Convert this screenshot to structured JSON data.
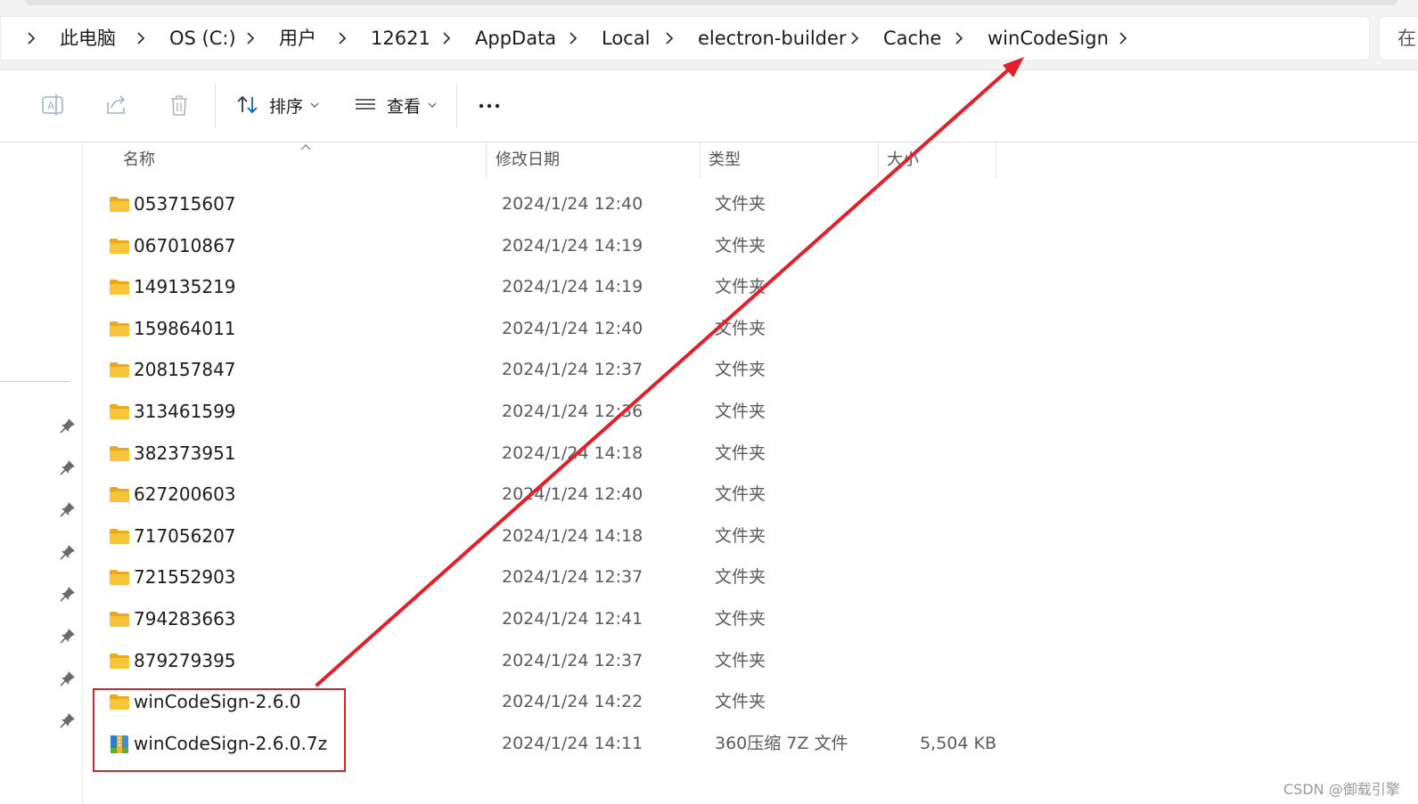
{
  "breadcrumb": [
    "此电脑",
    "OS (C:)",
    "用户",
    "12621",
    "AppData",
    "Local",
    "electron-builder",
    "Cache",
    "winCodeSign"
  ],
  "search_placeholder": "在",
  "toolbar": {
    "rename_icon": "rename-icon",
    "share_icon": "share-icon",
    "delete_icon": "trash-icon",
    "sort_label": "排序",
    "view_label": "查看",
    "more_label": "..."
  },
  "columns": {
    "name": "名称",
    "date": "修改日期",
    "type": "类型",
    "size": "大小"
  },
  "files": [
    {
      "name": "053715607",
      "date": "2024/1/24 12:40",
      "type": "文件夹",
      "size": "",
      "icon": "folder-icon"
    },
    {
      "name": "067010867",
      "date": "2024/1/24 14:19",
      "type": "文件夹",
      "size": "",
      "icon": "folder-icon"
    },
    {
      "name": "149135219",
      "date": "2024/1/24 14:19",
      "type": "文件夹",
      "size": "",
      "icon": "folder-icon"
    },
    {
      "name": "159864011",
      "date": "2024/1/24 12:40",
      "type": "文件夹",
      "size": "",
      "icon": "folder-icon"
    },
    {
      "name": "208157847",
      "date": "2024/1/24 12:37",
      "type": "文件夹",
      "size": "",
      "icon": "folder-icon"
    },
    {
      "name": "313461599",
      "date": "2024/1/24 12:36",
      "type": "文件夹",
      "size": "",
      "icon": "folder-icon"
    },
    {
      "name": "382373951",
      "date": "2024/1/24 14:18",
      "type": "文件夹",
      "size": "",
      "icon": "folder-icon"
    },
    {
      "name": "627200603",
      "date": "2024/1/24 12:40",
      "type": "文件夹",
      "size": "",
      "icon": "folder-icon"
    },
    {
      "name": "717056207",
      "date": "2024/1/24 14:18",
      "type": "文件夹",
      "size": "",
      "icon": "folder-icon"
    },
    {
      "name": "721552903",
      "date": "2024/1/24 12:37",
      "type": "文件夹",
      "size": "",
      "icon": "folder-icon"
    },
    {
      "name": "794283663",
      "date": "2024/1/24 12:41",
      "type": "文件夹",
      "size": "",
      "icon": "folder-icon"
    },
    {
      "name": "879279395",
      "date": "2024/1/24 12:37",
      "type": "文件夹",
      "size": "",
      "icon": "folder-icon"
    },
    {
      "name": "winCodeSign-2.6.0",
      "date": "2024/1/24 14:22",
      "type": "文件夹",
      "size": "",
      "icon": "folder-icon"
    },
    {
      "name": "winCodeSign-2.6.0.7z",
      "date": "2024/1/24 14:11",
      "type": "360压缩 7Z 文件",
      "size": "5,504 KB",
      "icon": "archive-icon"
    }
  ],
  "watermark": "CSDN @御载引擎",
  "colors": {
    "annotation": "#e3202a",
    "folder": "#f8c43a",
    "accent": "#0067c0"
  }
}
